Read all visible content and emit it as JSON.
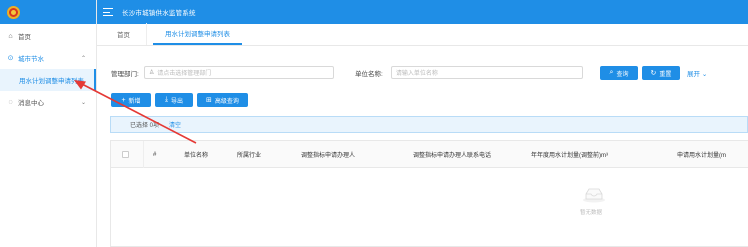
{
  "app": {
    "title": "长沙市城镇供水监管系统"
  },
  "sidebar": {
    "items": [
      {
        "label": "首页",
        "icon": "home-icon"
      },
      {
        "label": "城市节水",
        "icon": "settings-icon",
        "expanded": true,
        "children": [
          {
            "label": "用水计划调整申请列表"
          }
        ]
      },
      {
        "label": "消息中心",
        "icon": "message-icon"
      }
    ]
  },
  "tabs": {
    "home": "首页",
    "current": "用水计划调整申请列表"
  },
  "filters": {
    "dept_label": "管理部门:",
    "dept_placeholder": "请点击选择管理部门",
    "unit_label": "单位名称:",
    "unit_placeholder": "请输入单位名称",
    "search": "查询",
    "reset": "重置",
    "expand": "展开"
  },
  "toolbar": {
    "add": "新增",
    "export": "导出",
    "advanced": "高级查询"
  },
  "selection": {
    "selected": "已选择 0项",
    "clear": "清空"
  },
  "table": {
    "columns": [
      "#",
      "单位名称",
      "所属行业",
      "调整指标申请办理人",
      "调整指标申请办理人联系电话",
      "年年度用水计划量(调整前)m³",
      "申请用水计划量(m"
    ],
    "rows": [],
    "empty_text": "暂无数据"
  },
  "colors": {
    "primary": "#1f8ee6",
    "annotation_arrow": "#e53935"
  }
}
